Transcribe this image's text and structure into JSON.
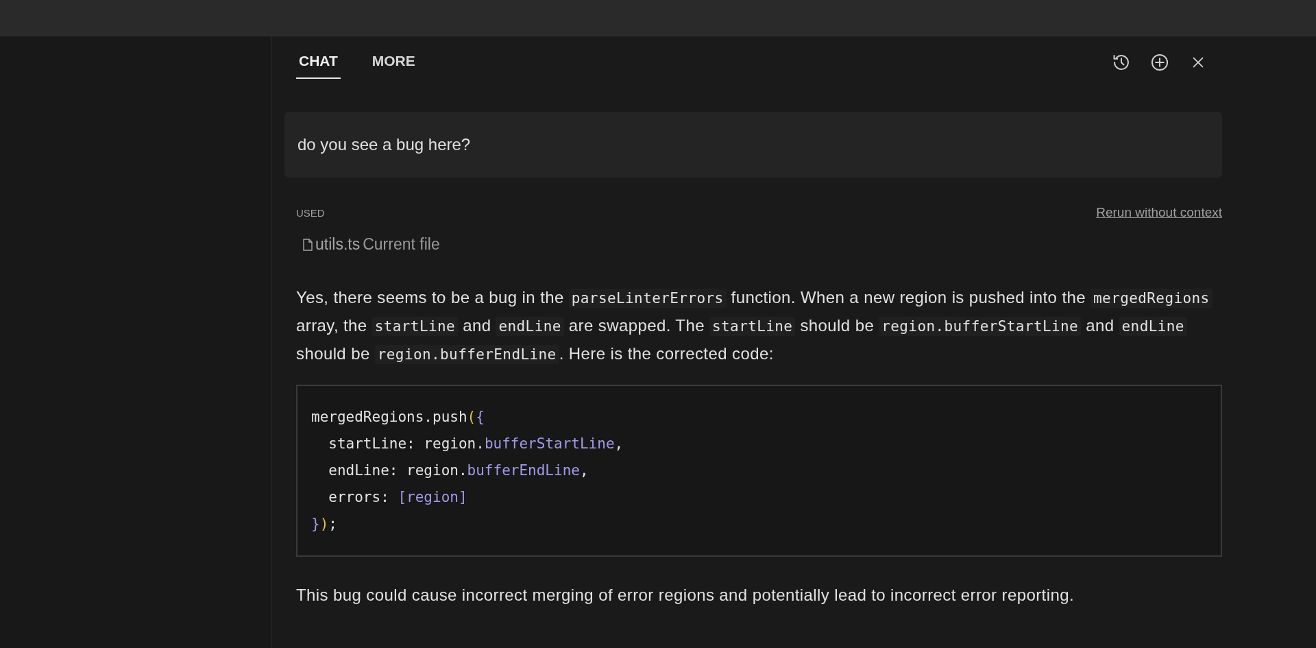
{
  "tabs": [
    {
      "label": "CHAT",
      "selected": true
    },
    {
      "label": "MORE",
      "selected": false
    }
  ],
  "user_message": "do you see a bug here?",
  "context": {
    "label": "USED",
    "rerun_link": "Rerun without context",
    "file": {
      "name": "utils.ts",
      "note": "Current file"
    }
  },
  "answer": [
    {
      "segments": [
        {
          "text": "Yes, there seems to be a bug in the ",
          "code": false
        },
        {
          "text": "parseLinterErrors",
          "code": true
        },
        {
          "text": " function. When a new region is pushed into the ",
          "code": false
        },
        {
          "text": "mergedRegions",
          "code": true
        },
        {
          "text": " array, the ",
          "code": false
        },
        {
          "text": "startLine",
          "code": true
        },
        {
          "text": " and ",
          "code": false
        },
        {
          "text": "endLine",
          "code": true
        },
        {
          "text": " are swapped. The ",
          "code": false
        },
        {
          "text": "startLine",
          "code": true
        },
        {
          "text": " should be ",
          "code": false
        },
        {
          "text": "region.bufferStartLine",
          "code": true
        },
        {
          "text": " and ",
          "code": false
        },
        {
          "text": "endLine",
          "code": true
        },
        {
          "text": " should be ",
          "code": false
        },
        {
          "text": "region.bufferEndLine",
          "code": true
        },
        {
          "text": ". Here is the corrected code:",
          "code": false
        }
      ]
    }
  ],
  "code_block": [
    {
      "tokens": [
        {
          "text": "mergedRegions.push",
          "kind": "plain"
        },
        {
          "text": "(",
          "kind": "paren"
        },
        {
          "text": "{",
          "kind": "accent"
        }
      ]
    },
    {
      "tokens": [
        {
          "text": "  startLine: region.",
          "kind": "plain"
        },
        {
          "text": "bufferStartLine",
          "kind": "accent"
        },
        {
          "text": ",",
          "kind": "plain"
        }
      ]
    },
    {
      "tokens": [
        {
          "text": "  endLine: region.",
          "kind": "plain"
        },
        {
          "text": "bufferEndLine",
          "kind": "accent"
        },
        {
          "text": ",",
          "kind": "plain"
        }
      ]
    },
    {
      "tokens": [
        {
          "text": "  errors: ",
          "kind": "plain"
        },
        {
          "text": "[region]",
          "kind": "accent"
        }
      ]
    },
    {
      "tokens": [
        {
          "text": "}",
          "kind": "accent"
        },
        {
          "text": ")",
          "kind": "paren"
        },
        {
          "text": ";",
          "kind": "plain"
        }
      ]
    }
  ],
  "closing": "This bug could cause incorrect merging of error regions and potentially lead to incorrect error reporting."
}
